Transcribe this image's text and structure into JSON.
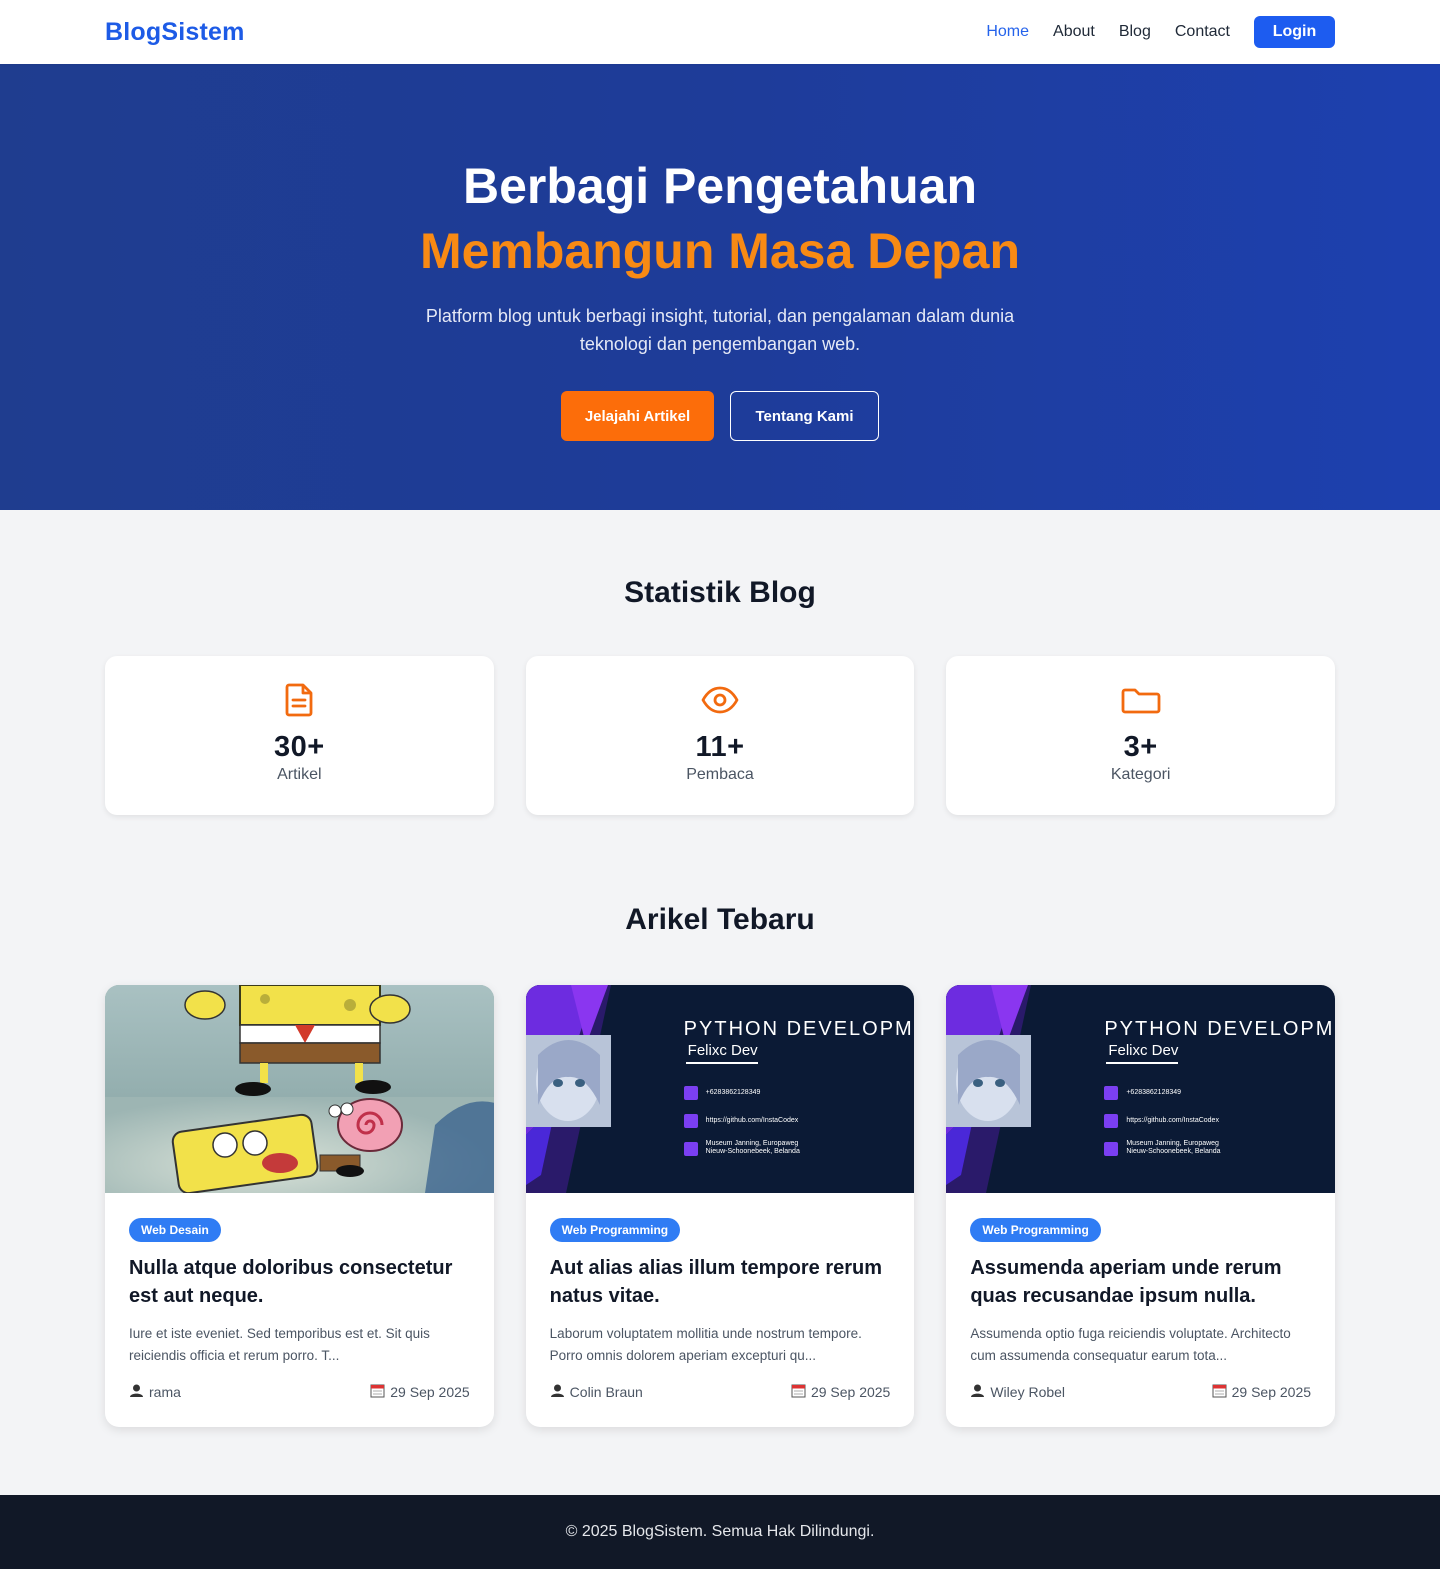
{
  "nav": {
    "brand": "BlogSistem",
    "links": [
      "Home",
      "About",
      "Blog",
      "Contact"
    ],
    "login": "Login"
  },
  "hero": {
    "title_line1": "Berbagi Pengetahuan",
    "title_line2": "Membangun Masa Depan",
    "subtitle": "Platform blog untuk berbagi insight, tutorial, dan pengalaman dalam dunia teknologi dan pengembangan web.",
    "primary_button": "Jelajahi Artikel",
    "secondary_button": "Tentang Kami"
  },
  "stats": {
    "title": "Statistik Blog",
    "items": [
      {
        "icon": "document-icon",
        "value": "30+",
        "label": "Artikel"
      },
      {
        "icon": "eye-icon",
        "value": "11+",
        "label": "Pembaca"
      },
      {
        "icon": "folder-icon",
        "value": "3+",
        "label": "Kategori"
      }
    ]
  },
  "articles": {
    "title": "Arikel Tebaru",
    "items": [
      {
        "category": "Web Desain",
        "title": "Nulla atque doloribus consectetur est aut neque.",
        "excerpt": "Iure et iste eveniet. Sed temporibus est et. Sit quis reiciendis officia et rerum porro. T...",
        "author": "rama",
        "date": "29 Sep 2025"
      },
      {
        "category": "Web Programming",
        "title": "Aut alias alias illum tempore rerum natus vitae.",
        "excerpt": "Laborum voluptatem mollitia unde nostrum tempore. Porro omnis dolorem aperiam excepturi qu...",
        "author": "Colin Braun",
        "date": "29 Sep 2025",
        "image_text": {
          "heading": "PYTHON DEVELOPME",
          "name": "Felixc Dev",
          "phone": "+6283862128349",
          "url": "https://github.com/InstaCodex",
          "address1": "Museum Janning, Europaweg",
          "address2": "Nieuw-Schoonebeek, Belanda"
        }
      },
      {
        "category": "Web Programming",
        "title": "Assumenda aperiam unde rerum quas recusandae ipsum nulla.",
        "excerpt": "Assumenda optio fuga reiciendis voluptate. Architecto cum assumenda consequatur earum tota...",
        "author": "Wiley Robel",
        "date": "29 Sep 2025",
        "image_text": {
          "heading": "PYTHON DEVELOPME",
          "name": "Felixc Dev",
          "phone": "+6283862128349",
          "url": "https://github.com/InstaCodex",
          "address1": "Museum Janning, Europaweg",
          "address2": "Nieuw-Schoonebeek, Belanda"
        }
      }
    ]
  },
  "footer": {
    "text": "© 2025 BlogSistem. Semua Hak Dilindungi."
  },
  "colors": {
    "brand_blue": "#1d5be6",
    "hero_blue": "#1e3c99",
    "accent_orange": "#f88a14",
    "badge_blue": "#2f7cf4",
    "footer_dark": "#111827"
  }
}
